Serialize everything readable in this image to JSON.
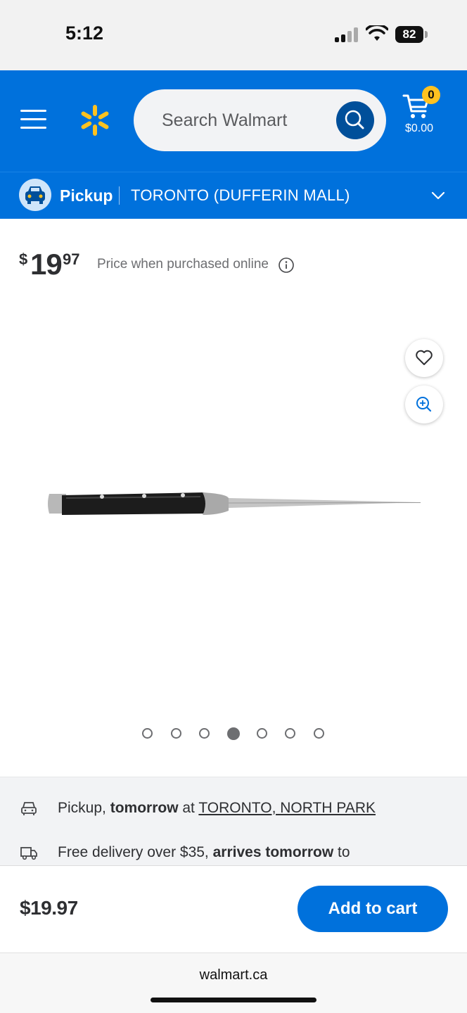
{
  "status_bar": {
    "time": "5:12",
    "battery": "82"
  },
  "header": {
    "search_placeholder": "Search Walmart",
    "cart_count": "0",
    "cart_total": "$0.00",
    "pickup": {
      "label": "Pickup",
      "separator": "|",
      "store": "TORONTO (DUFFERIN MALL)"
    }
  },
  "product": {
    "price_dollar_sign": "$",
    "price_whole": "19",
    "price_cents": "97",
    "price_note": "Price when purchased online",
    "image_count": 7,
    "active_image": 4
  },
  "fulfillment": {
    "pickup": {
      "prefix": "Pickup, ",
      "when": "tomorrow",
      "at": " at ",
      "store": "TORONTO, NORTH PARK"
    },
    "delivery": {
      "prefix": "Free delivery over $35, ",
      "when": "arrives tomorrow",
      "suffix": " to"
    }
  },
  "cart_bar": {
    "price": "$19.97",
    "button": "Add to cart"
  },
  "browser": {
    "url": "walmart.ca"
  },
  "colors": {
    "brand_blue": "#0071dc",
    "spark_yellow": "#ffc220",
    "dark_blue": "#004f9a"
  },
  "icons": [
    "menu-icon",
    "spark-logo-icon",
    "search-icon",
    "cart-icon",
    "car-icon",
    "chevron-down-icon",
    "info-icon",
    "heart-icon",
    "zoom-in-icon",
    "truck-icon"
  ]
}
